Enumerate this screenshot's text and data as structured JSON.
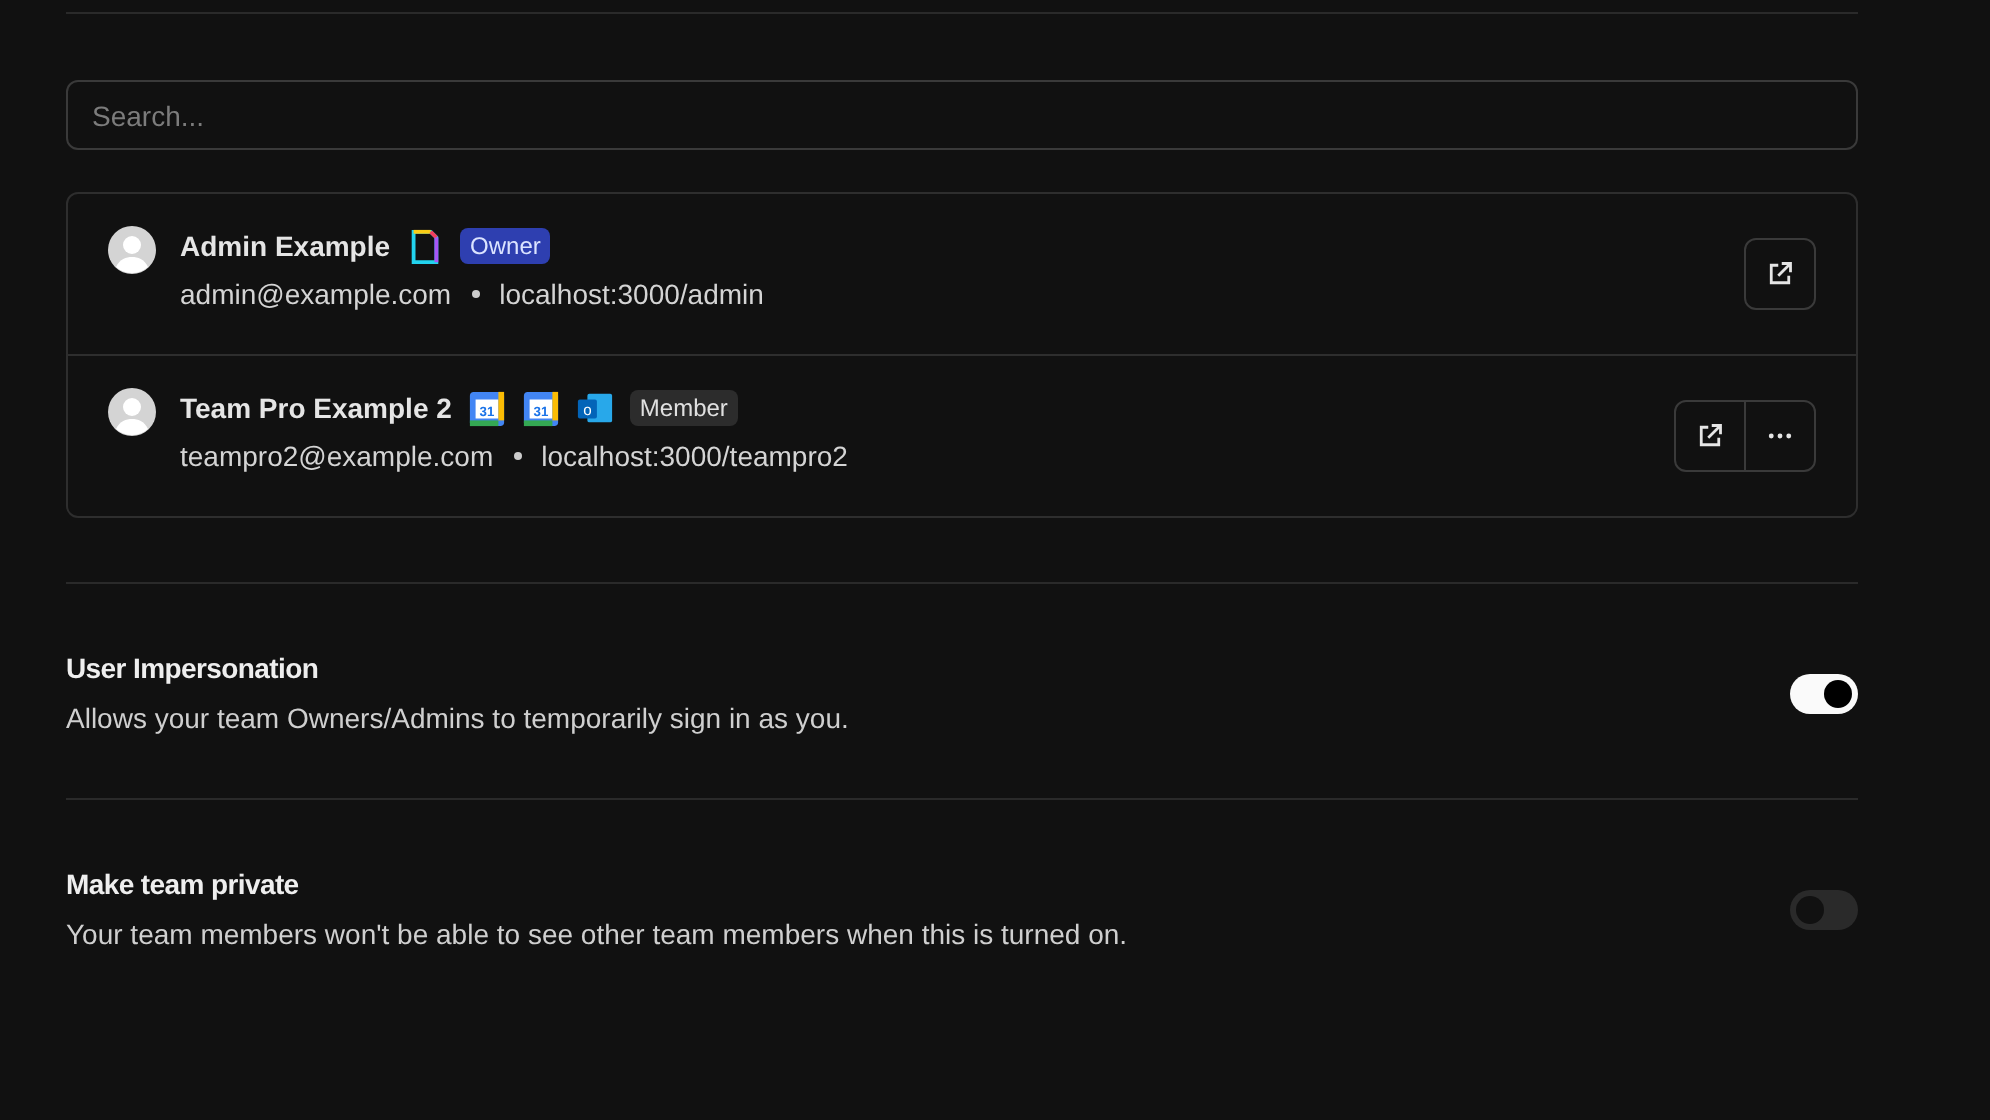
{
  "search": {
    "placeholder": "Search..."
  },
  "members": [
    {
      "name": "Admin Example",
      "apps": [
        {
          "kind": "document"
        }
      ],
      "role": {
        "label": "Owner",
        "kind": "owner"
      },
      "email": "admin@example.com",
      "url": "localhost:3000/admin",
      "actions": [
        {
          "kind": "open"
        }
      ]
    },
    {
      "name": "Team Pro Example 2",
      "apps": [
        {
          "kind": "calendar",
          "label": "31"
        },
        {
          "kind": "calendar",
          "label": "31"
        },
        {
          "kind": "mail",
          "label": "o"
        }
      ],
      "role": {
        "label": "Member",
        "kind": "member"
      },
      "email": "teampro2@example.com",
      "url": "localhost:3000/teampro2",
      "actions": [
        {
          "kind": "open"
        },
        {
          "kind": "more"
        }
      ]
    }
  ],
  "settings": [
    {
      "title": "User Impersonation",
      "description": "Allows your team Owners/Admins to temporarily sign in as you.",
      "on": true
    },
    {
      "title": "Make team private",
      "description": "Your team members won't be able to see other team members when this is turned on.",
      "on": false
    }
  ]
}
